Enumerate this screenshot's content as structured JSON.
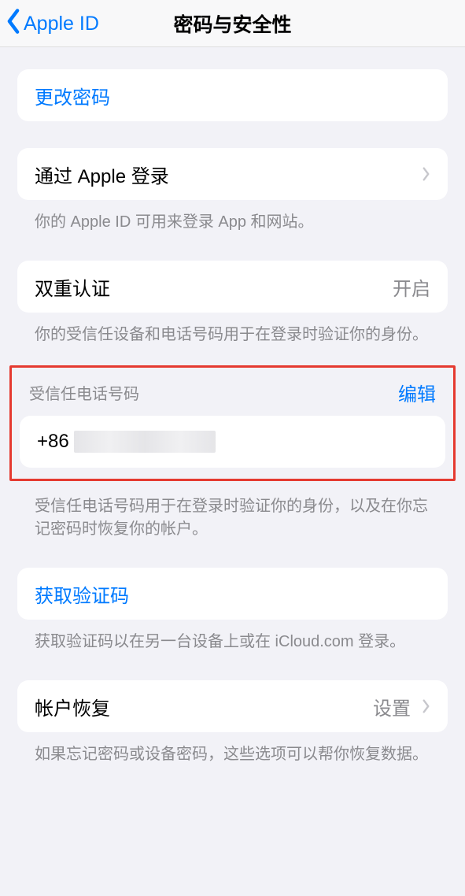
{
  "nav": {
    "back_label": "Apple ID",
    "title": "密码与安全性"
  },
  "change_password": {
    "label": "更改密码"
  },
  "sign_in_with_apple": {
    "label": "通过 Apple 登录",
    "footer": "你的 Apple ID 可用来登录 App 和网站。"
  },
  "two_factor": {
    "label": "双重认证",
    "value": "开启",
    "footer": "你的受信任设备和电话号码用于在登录时验证你的身份。"
  },
  "trusted_phone": {
    "header": "受信任电话号码",
    "edit": "编辑",
    "prefix": "+86",
    "footer": "受信任电话号码用于在登录时验证你的身份，以及在你忘记密码时恢复你的帐户。"
  },
  "get_code": {
    "label": "获取验证码",
    "footer": "获取验证码以在另一台设备上或在 iCloud.com 登录。"
  },
  "account_recovery": {
    "label": "帐户恢复",
    "value": "设置",
    "footer": "如果忘记密码或设备密码，这些选项可以帮你恢复数据。"
  }
}
